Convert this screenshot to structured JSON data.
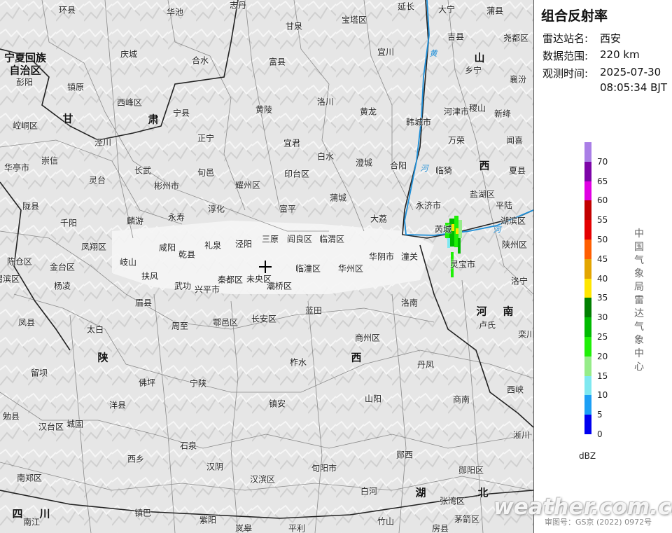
{
  "panel": {
    "title": "组合反射率",
    "station_label": "雷达站名:",
    "station_value": "西安",
    "range_label": "数据范围:",
    "range_value": "220 km",
    "time_label": "观测时间:",
    "time_date": "2025-07-30",
    "time_clock": "08:05:34 BJT"
  },
  "legend": {
    "ticks": [
      "70",
      "65",
      "60",
      "55",
      "50",
      "45",
      "40",
      "35",
      "30",
      "25",
      "20",
      "15",
      "10",
      "5",
      "0"
    ],
    "colors": [
      "#a97ee6",
      "#7d04a8",
      "#e000e3",
      "#c20000",
      "#e40000",
      "#ff5e00",
      "#e3a500",
      "#ffe600",
      "#007f00",
      "#00ba00",
      "#1ff007",
      "#96ec89",
      "#7fe8f0",
      "#1c9ff5",
      "#0000f0"
    ],
    "unit": "dBZ"
  },
  "organization": "中国气象局雷达气象中心",
  "watermark": "weather.com.cn",
  "approval": "审图号：GS京 (2022) 0972号",
  "map": {
    "radar_center_icon": "radar-site-cross-icon",
    "rivers": [
      "黄",
      "河",
      "河",
      "河"
    ],
    "provinces": [
      "宁夏回族",
      "自治区",
      "甘",
      "肃",
      "山",
      "西",
      "陕",
      "西",
      "河",
      "南",
      "湖",
      "北",
      "四",
      "川"
    ],
    "places": [
      "环县",
      "华池",
      "志丹",
      "延长",
      "大宁",
      "蒲县",
      "甘泉",
      "宝塔区",
      "宜川",
      "吉县",
      "尧都区",
      "庆城",
      "合水",
      "富县",
      "乡宁",
      "襄汾",
      "彭阳",
      "镇原",
      "西峰区",
      "宁县",
      "洛川",
      "黄陵",
      "黄龙",
      "韩城市",
      "河津市",
      "稷山",
      "新绛",
      "崆峒区",
      "泾川",
      "正宁",
      "宜君",
      "白水",
      "万荣",
      "闻喜",
      "华亭市",
      "崇信",
      "长武",
      "旬邑",
      "印台区",
      "澄城",
      "合阳",
      "临猗",
      "夏县",
      "灵台",
      "彬州市",
      "耀州区",
      "蒲城",
      "盐湖区",
      "平陆",
      "陇县",
      "千阳",
      "麟游",
      "永寿",
      "淳化",
      "富平",
      "大荔",
      "永济市",
      "湖滨区",
      "凤翔区",
      "乾县",
      "礼泉",
      "泾阳",
      "三原",
      "阎良区",
      "临渭区",
      "华阴市",
      "潼关",
      "芮城",
      "陕州区",
      "陈仓区",
      "金台区",
      "岐山",
      "扶风",
      "咸阳",
      "临潼区",
      "华州区",
      "灵宝市",
      "渭滨区",
      "杨凌",
      "武功",
      "兴平市",
      "秦都区",
      "未央区",
      "灞桥区",
      "洛宁",
      "眉县",
      "长安区",
      "蓝田",
      "洛南",
      "卢氏",
      "凤县",
      "太白",
      "周至",
      "鄠邑区",
      "商州区",
      "栾川",
      "留坝",
      "佛坪",
      "宁陕",
      "柞水",
      "丹凤",
      "西峡",
      "洋县",
      "镇安",
      "山阳",
      "商南",
      "勉县",
      "汉台区",
      "城固",
      "淅川",
      "石泉",
      "南郑区",
      "西乡",
      "汉阴",
      "旬阳市",
      "郧西",
      "郧阳区",
      "汉滨区",
      "白河",
      "张湾区",
      "南江",
      "镇巴",
      "紫阳",
      "岚皋",
      "平利",
      "竹山",
      "茅箭区",
      "房县"
    ]
  }
}
